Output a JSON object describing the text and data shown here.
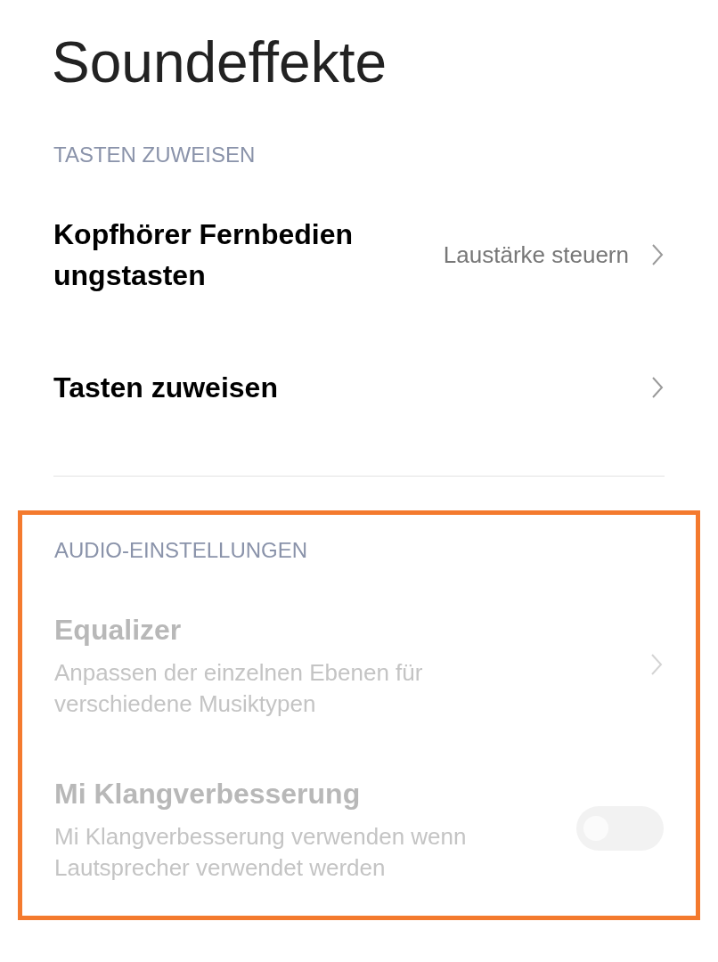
{
  "title": "Soundeffekte",
  "sections": [
    {
      "header": "TASTEN ZUWEISEN",
      "items": [
        {
          "kind": "link",
          "label": "Kopfhörer Fernbedien ungstasten",
          "value": "Laustärke steuern",
          "disabled": false
        },
        {
          "kind": "link",
          "label": "Tasten zuweisen",
          "disabled": false
        }
      ]
    },
    {
      "header": "AUDIO-EINSTELLUNGEN",
      "highlighted": true,
      "items": [
        {
          "kind": "link",
          "label": "Equalizer",
          "description": "Anpassen der einzelnen Ebenen für verschiedene Musiktypen",
          "disabled": true
        },
        {
          "kind": "toggle",
          "label": "Mi Klangverbesserung",
          "description": "Mi Klangverbesserung verwenden wenn Lautsprecher verwendet werden",
          "disabled": true,
          "on": false
        }
      ]
    }
  ]
}
